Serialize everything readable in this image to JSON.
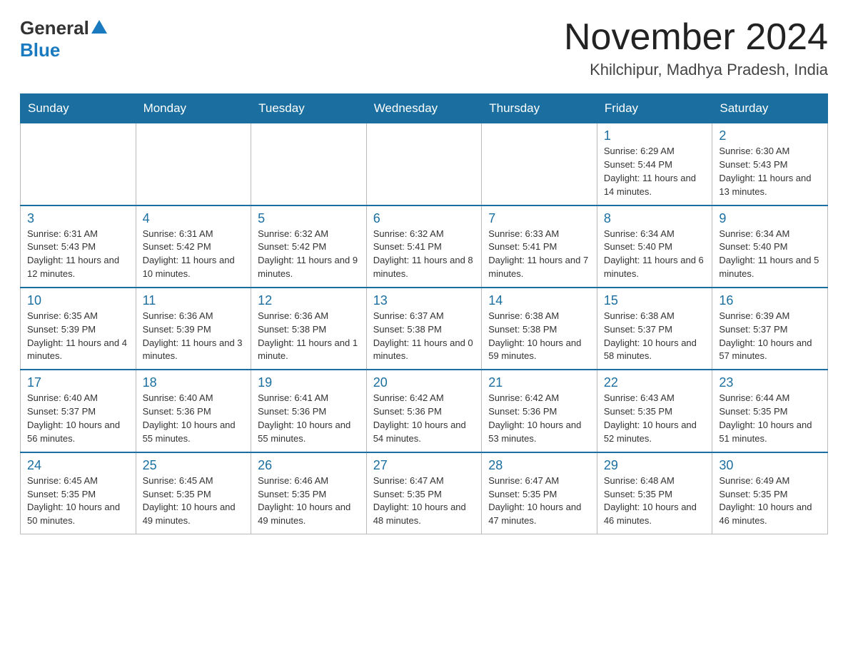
{
  "header": {
    "logo_general": "General",
    "logo_blue": "Blue",
    "month_title": "November 2024",
    "location": "Khilchipur, Madhya Pradesh, India"
  },
  "weekdays": [
    "Sunday",
    "Monday",
    "Tuesday",
    "Wednesday",
    "Thursday",
    "Friday",
    "Saturday"
  ],
  "rows": [
    {
      "cells": [
        {
          "day": "",
          "sunrise": "",
          "sunset": "",
          "daylight": "",
          "empty": true
        },
        {
          "day": "",
          "sunrise": "",
          "sunset": "",
          "daylight": "",
          "empty": true
        },
        {
          "day": "",
          "sunrise": "",
          "sunset": "",
          "daylight": "",
          "empty": true
        },
        {
          "day": "",
          "sunrise": "",
          "sunset": "",
          "daylight": "",
          "empty": true
        },
        {
          "day": "",
          "sunrise": "",
          "sunset": "",
          "daylight": "",
          "empty": true
        },
        {
          "day": "1",
          "sunrise": "Sunrise: 6:29 AM",
          "sunset": "Sunset: 5:44 PM",
          "daylight": "Daylight: 11 hours and 14 minutes."
        },
        {
          "day": "2",
          "sunrise": "Sunrise: 6:30 AM",
          "sunset": "Sunset: 5:43 PM",
          "daylight": "Daylight: 11 hours and 13 minutes."
        }
      ]
    },
    {
      "cells": [
        {
          "day": "3",
          "sunrise": "Sunrise: 6:31 AM",
          "sunset": "Sunset: 5:43 PM",
          "daylight": "Daylight: 11 hours and 12 minutes."
        },
        {
          "day": "4",
          "sunrise": "Sunrise: 6:31 AM",
          "sunset": "Sunset: 5:42 PM",
          "daylight": "Daylight: 11 hours and 10 minutes."
        },
        {
          "day": "5",
          "sunrise": "Sunrise: 6:32 AM",
          "sunset": "Sunset: 5:42 PM",
          "daylight": "Daylight: 11 hours and 9 minutes."
        },
        {
          "day": "6",
          "sunrise": "Sunrise: 6:32 AM",
          "sunset": "Sunset: 5:41 PM",
          "daylight": "Daylight: 11 hours and 8 minutes."
        },
        {
          "day": "7",
          "sunrise": "Sunrise: 6:33 AM",
          "sunset": "Sunset: 5:41 PM",
          "daylight": "Daylight: 11 hours and 7 minutes."
        },
        {
          "day": "8",
          "sunrise": "Sunrise: 6:34 AM",
          "sunset": "Sunset: 5:40 PM",
          "daylight": "Daylight: 11 hours and 6 minutes."
        },
        {
          "day": "9",
          "sunrise": "Sunrise: 6:34 AM",
          "sunset": "Sunset: 5:40 PM",
          "daylight": "Daylight: 11 hours and 5 minutes."
        }
      ]
    },
    {
      "cells": [
        {
          "day": "10",
          "sunrise": "Sunrise: 6:35 AM",
          "sunset": "Sunset: 5:39 PM",
          "daylight": "Daylight: 11 hours and 4 minutes."
        },
        {
          "day": "11",
          "sunrise": "Sunrise: 6:36 AM",
          "sunset": "Sunset: 5:39 PM",
          "daylight": "Daylight: 11 hours and 3 minutes."
        },
        {
          "day": "12",
          "sunrise": "Sunrise: 6:36 AM",
          "sunset": "Sunset: 5:38 PM",
          "daylight": "Daylight: 11 hours and 1 minute."
        },
        {
          "day": "13",
          "sunrise": "Sunrise: 6:37 AM",
          "sunset": "Sunset: 5:38 PM",
          "daylight": "Daylight: 11 hours and 0 minutes."
        },
        {
          "day": "14",
          "sunrise": "Sunrise: 6:38 AM",
          "sunset": "Sunset: 5:38 PM",
          "daylight": "Daylight: 10 hours and 59 minutes."
        },
        {
          "day": "15",
          "sunrise": "Sunrise: 6:38 AM",
          "sunset": "Sunset: 5:37 PM",
          "daylight": "Daylight: 10 hours and 58 minutes."
        },
        {
          "day": "16",
          "sunrise": "Sunrise: 6:39 AM",
          "sunset": "Sunset: 5:37 PM",
          "daylight": "Daylight: 10 hours and 57 minutes."
        }
      ]
    },
    {
      "cells": [
        {
          "day": "17",
          "sunrise": "Sunrise: 6:40 AM",
          "sunset": "Sunset: 5:37 PM",
          "daylight": "Daylight: 10 hours and 56 minutes."
        },
        {
          "day": "18",
          "sunrise": "Sunrise: 6:40 AM",
          "sunset": "Sunset: 5:36 PM",
          "daylight": "Daylight: 10 hours and 55 minutes."
        },
        {
          "day": "19",
          "sunrise": "Sunrise: 6:41 AM",
          "sunset": "Sunset: 5:36 PM",
          "daylight": "Daylight: 10 hours and 55 minutes."
        },
        {
          "day": "20",
          "sunrise": "Sunrise: 6:42 AM",
          "sunset": "Sunset: 5:36 PM",
          "daylight": "Daylight: 10 hours and 54 minutes."
        },
        {
          "day": "21",
          "sunrise": "Sunrise: 6:42 AM",
          "sunset": "Sunset: 5:36 PM",
          "daylight": "Daylight: 10 hours and 53 minutes."
        },
        {
          "day": "22",
          "sunrise": "Sunrise: 6:43 AM",
          "sunset": "Sunset: 5:35 PM",
          "daylight": "Daylight: 10 hours and 52 minutes."
        },
        {
          "day": "23",
          "sunrise": "Sunrise: 6:44 AM",
          "sunset": "Sunset: 5:35 PM",
          "daylight": "Daylight: 10 hours and 51 minutes."
        }
      ]
    },
    {
      "cells": [
        {
          "day": "24",
          "sunrise": "Sunrise: 6:45 AM",
          "sunset": "Sunset: 5:35 PM",
          "daylight": "Daylight: 10 hours and 50 minutes."
        },
        {
          "day": "25",
          "sunrise": "Sunrise: 6:45 AM",
          "sunset": "Sunset: 5:35 PM",
          "daylight": "Daylight: 10 hours and 49 minutes."
        },
        {
          "day": "26",
          "sunrise": "Sunrise: 6:46 AM",
          "sunset": "Sunset: 5:35 PM",
          "daylight": "Daylight: 10 hours and 49 minutes."
        },
        {
          "day": "27",
          "sunrise": "Sunrise: 6:47 AM",
          "sunset": "Sunset: 5:35 PM",
          "daylight": "Daylight: 10 hours and 48 minutes."
        },
        {
          "day": "28",
          "sunrise": "Sunrise: 6:47 AM",
          "sunset": "Sunset: 5:35 PM",
          "daylight": "Daylight: 10 hours and 47 minutes."
        },
        {
          "day": "29",
          "sunrise": "Sunrise: 6:48 AM",
          "sunset": "Sunset: 5:35 PM",
          "daylight": "Daylight: 10 hours and 46 minutes."
        },
        {
          "day": "30",
          "sunrise": "Sunrise: 6:49 AM",
          "sunset": "Sunset: 5:35 PM",
          "daylight": "Daylight: 10 hours and 46 minutes."
        }
      ]
    }
  ]
}
